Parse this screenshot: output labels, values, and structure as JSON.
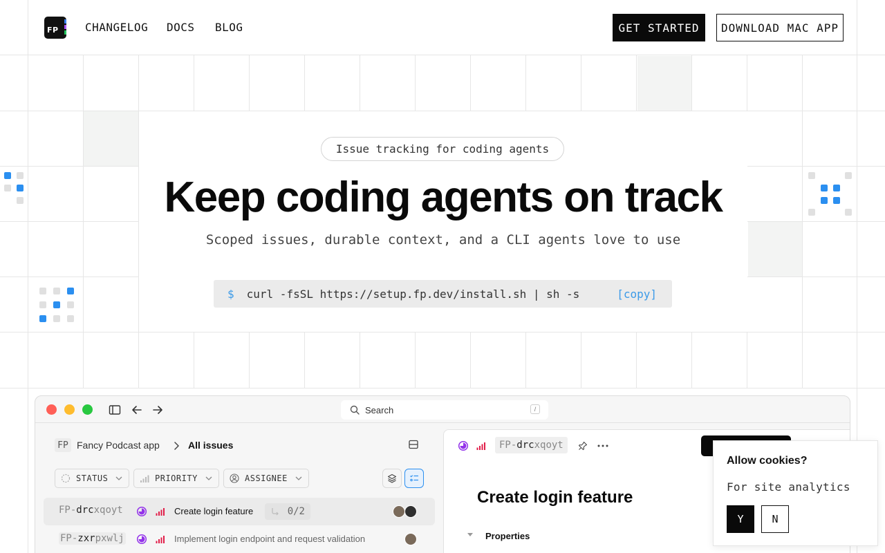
{
  "header": {
    "logo_text": "FP",
    "nav": [
      "CHANGELOG",
      "DOCS",
      "BLOG"
    ],
    "cta_primary": "GET STARTED",
    "cta_secondary": "DOWNLOAD MAC APP"
  },
  "hero": {
    "pill": "Issue tracking for coding agents",
    "headline": "Keep coding agents on track",
    "subline": "Scoped issues, durable context, and a CLI agents love to use",
    "command_prompt": "$",
    "command": "curl -fsSL https://setup.fp.dev/install.sh | sh -s",
    "copy_label": "[copy]"
  },
  "app": {
    "search_placeholder": "Search",
    "search_shortcut": "/",
    "breadcrumb": {
      "badge": "FP",
      "project": "Fancy Podcast app",
      "separator": ">",
      "current": "All issues"
    },
    "filters": [
      "STATUS",
      "PRIORITY",
      "ASSIGNEE"
    ],
    "issues": [
      {
        "id_prefix": "FP-",
        "id_bold": "drc",
        "id_rest": "xqoyt",
        "title": "Create login feature",
        "subtasks": "0/2"
      },
      {
        "id_prefix": "FP-",
        "id_bold": "zxr",
        "id_rest": "pxwlj",
        "title": "Implement login endpoint and request validation"
      }
    ],
    "detail": {
      "id_prefix": "FP-",
      "id_bold": "drc",
      "id_rest": "xqoyt",
      "title": "Create login feature",
      "properties_label": "Properties"
    }
  },
  "cookie": {
    "title": "Allow cookies?",
    "description": "For site analytics",
    "yes": "Y",
    "no": "N"
  },
  "colors": {
    "accent_blue": "#2b8ff0",
    "status_purple": "#9333ea",
    "priority_red": "#e11d48"
  }
}
